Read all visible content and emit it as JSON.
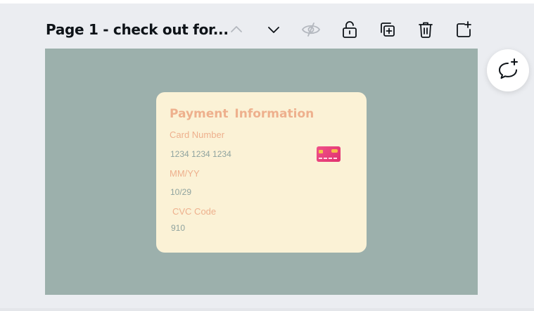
{
  "page": {
    "title": "Page 1 - check out for..."
  },
  "toolbar": {
    "icons": [
      "chevron-up-icon",
      "chevron-down-icon",
      "hide-icon",
      "unlock-icon",
      "duplicate-icon",
      "trash-icon",
      "add-page-icon"
    ]
  },
  "card": {
    "title": "Payment  Information",
    "card_number_label": "Card Number",
    "card_number_value": "1234 1234 1234",
    "expiry_label": "MM/YY",
    "expiry_value": "10/29",
    "cvc_label": "CVC Code",
    "cvc_value": "910"
  },
  "colors": {
    "canvas_bg": "#9cb0ac",
    "card_bg": "#fbf2d6",
    "label_color": "#eeb08d",
    "value_color": "#8fa39f",
    "credit_card": "#e83d7b"
  },
  "comment": {
    "icon": "add-comment-icon"
  }
}
